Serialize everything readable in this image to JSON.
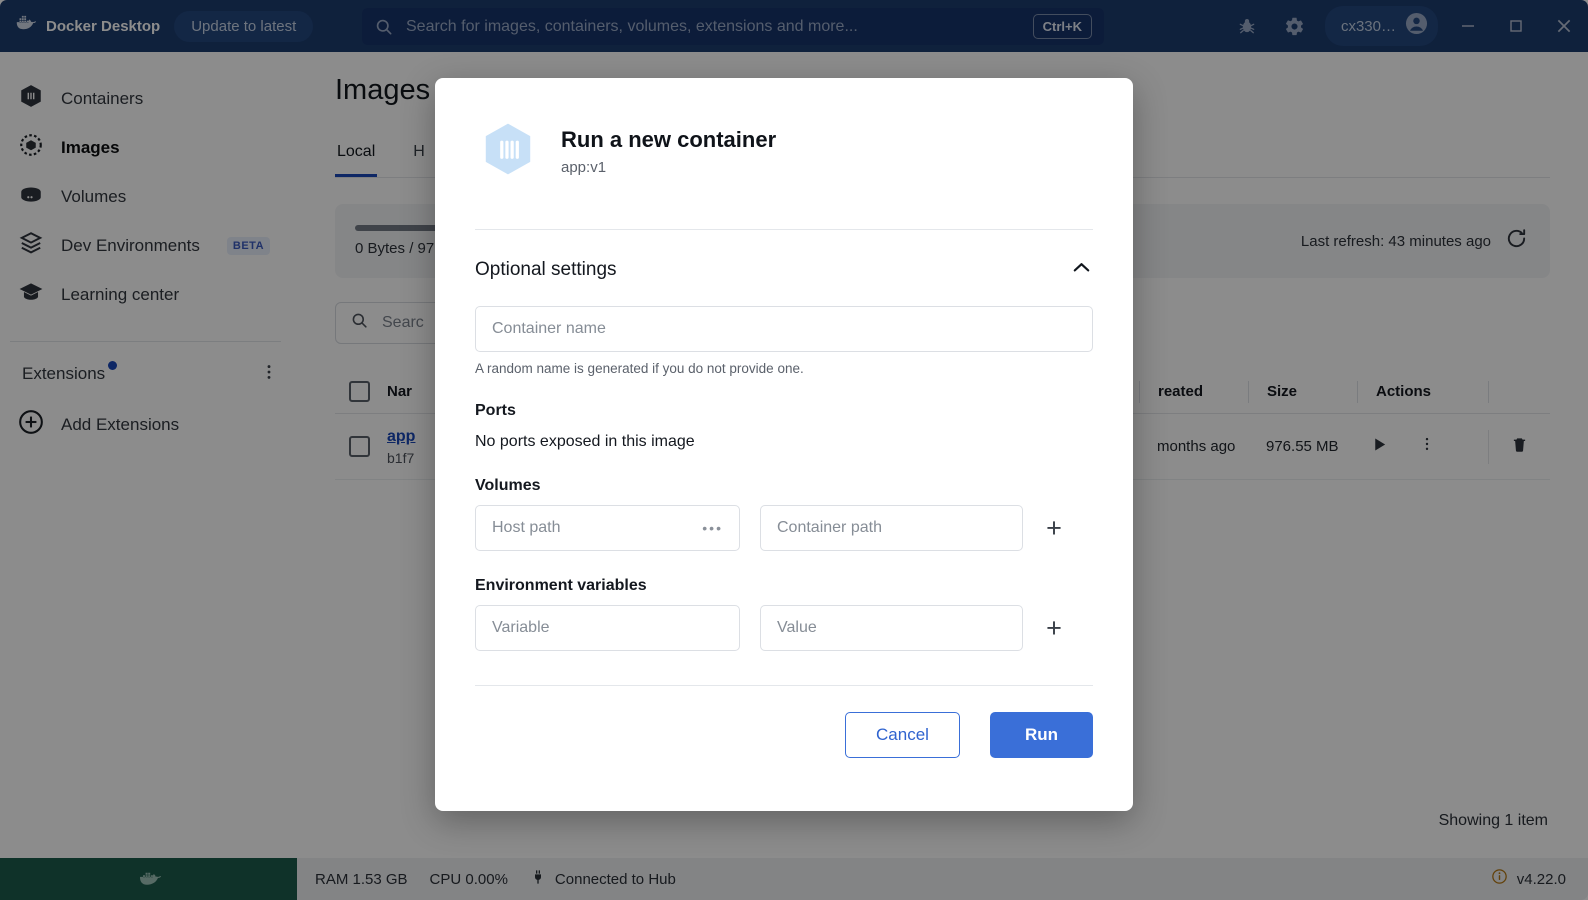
{
  "titlebar": {
    "brand": "Docker Desktop",
    "update_label": "Update to latest",
    "search_placeholder": "Search for images, containers, volumes, extensions and more...",
    "shortcut": "Ctrl+K",
    "bug_icon": "bug-icon",
    "settings_icon": "gear-icon",
    "username": "cx330…",
    "minimize_label": "—",
    "maximize_label": "□",
    "close_label": "✕",
    "bg_color": "#1d3c6e"
  },
  "sidebar": {
    "items": [
      {
        "label": "Containers",
        "icon": "containers-icon",
        "active": false
      },
      {
        "label": "Images",
        "icon": "images-icon",
        "active": true
      },
      {
        "label": "Volumes",
        "icon": "volumes-icon",
        "active": false
      },
      {
        "label": "Dev Environments",
        "icon": "dev-environments-icon",
        "active": false,
        "badge": "BETA"
      },
      {
        "label": "Learning center",
        "icon": "learning-center-icon",
        "active": false
      }
    ],
    "extensions_title": "Extensions",
    "extensions_menu_icon": "kebab-menu-icon",
    "add_extensions_label": "Add Extensions",
    "add_extensions_icon": "plus-circle-icon"
  },
  "main": {
    "page_title": "Images",
    "tabs": [
      {
        "label": "Local",
        "active": true
      },
      {
        "label": "H",
        "active": false
      }
    ],
    "storage": {
      "text": "0 Bytes / 97",
      "refresh_text": "Last refresh: 43 minutes ago",
      "refresh_icon": "refresh-icon"
    },
    "search_placeholder": "Searc",
    "search_icon": "search-icon",
    "table": {
      "headers": [
        "Nar",
        "reated",
        "Size",
        "Actions"
      ],
      "rows": [
        {
          "name": "app",
          "id": "b1f7",
          "created": "months ago",
          "size": "976.55 MB",
          "run_icon": "play-icon",
          "menu_icon": "kebab-menu-icon",
          "delete_icon": "trash-icon"
        }
      ]
    },
    "showing": "Showing 1 item"
  },
  "statusbar": {
    "whale_icon": "docker-whale-icon",
    "ram": "RAM 1.53 GB",
    "cpu": "CPU 0.00%",
    "connection_icon": "plug-icon",
    "connection": "Connected to Hub",
    "info_icon": "info-icon",
    "version": "v4.22.0"
  },
  "modal": {
    "icon": "container-cube-icon",
    "title": "Run a new container",
    "subtitle": "app:v1",
    "optional_settings_label": "Optional settings",
    "collapse_icon": "chevron-up-icon",
    "container_name_placeholder": "Container name",
    "container_name_value": "",
    "container_name_helper": "A random name is generated if you do not provide one.",
    "ports_label": "Ports",
    "ports_note": "No ports exposed in this image",
    "volumes_label": "Volumes",
    "host_path_placeholder": "Host path",
    "host_path_value": "",
    "host_path_browse_icon": "ellipsis-icon",
    "container_path_placeholder": "Container path",
    "container_path_value": "",
    "add_volume_label": "+",
    "env_label": "Environment variables",
    "variable_placeholder": "Variable",
    "variable_value": "",
    "value_placeholder": "Value",
    "value_value": "",
    "add_env_label": "+",
    "cancel_label": "Cancel",
    "run_label": "Run",
    "accent_color": "#3a6fd8"
  }
}
